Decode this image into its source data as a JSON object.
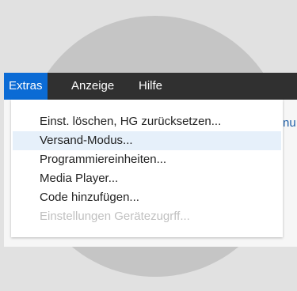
{
  "menubar": {
    "items": [
      {
        "label": "Extras",
        "active": true
      },
      {
        "label": "Anzeige",
        "active": false
      },
      {
        "label": "Hilfe",
        "active": false
      }
    ]
  },
  "document": {
    "partial_text": "nu"
  },
  "dropdown": {
    "items": [
      {
        "label": "Einst. löschen, HG zurücksetzen...",
        "state": "normal"
      },
      {
        "label": "Versand-Modus...",
        "state": "highlighted"
      },
      {
        "label": "Programmiereinheiten...",
        "state": "normal"
      },
      {
        "label": "Media Player...",
        "state": "normal"
      },
      {
        "label": "Code hinzufügen...",
        "state": "normal"
      },
      {
        "label": "Einstellungen Gerätezugrff...",
        "state": "disabled"
      }
    ]
  },
  "colors": {
    "menubar_bg": "#303030",
    "active_menu_bg": "#0b6bd5",
    "highlight_bg": "#e6f0fa",
    "disabled_text": "#c0c0c0",
    "backdrop": "#e1e1e1",
    "circle": "#c5c5c5"
  }
}
